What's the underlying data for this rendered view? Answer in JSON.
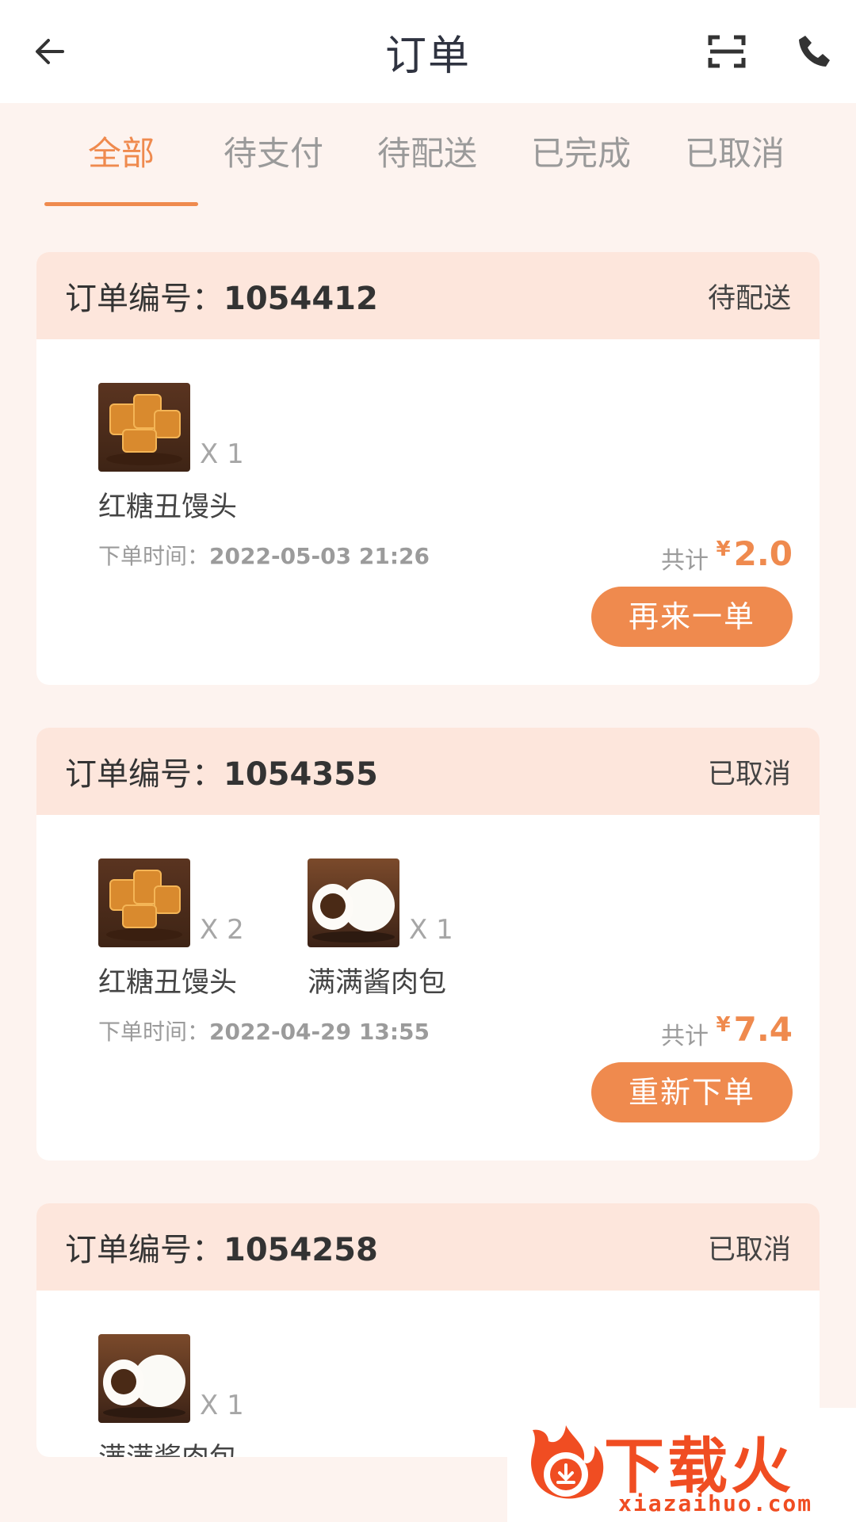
{
  "header": {
    "title": "订单",
    "icons": [
      "back-arrow-icon",
      "scan-icon",
      "phone-icon"
    ]
  },
  "tabs": [
    {
      "label": "全部",
      "active": true
    },
    {
      "label": "待支付",
      "active": false
    },
    {
      "label": "待配送",
      "active": false
    },
    {
      "label": "已完成",
      "active": false
    },
    {
      "label": "已取消",
      "active": false
    }
  ],
  "orders": [
    {
      "number_label": "订单编号：",
      "number": "1054412",
      "status": "待配送",
      "items": [
        {
          "name": "红糖丑馒头",
          "qty": "X 1",
          "thumb": "brown-sugar-bread"
        }
      ],
      "time_label": "下单时间：",
      "time": "2022-05-03 21:26",
      "total_label": "共计",
      "currency": "¥",
      "total": "2.0",
      "action": "再来一单"
    },
    {
      "number_label": "订单编号：",
      "number": "1054355",
      "status": "已取消",
      "items": [
        {
          "name": "红糖丑馒头",
          "qty": "X 2",
          "thumb": "brown-sugar-bread"
        },
        {
          "name": "满满酱肉包",
          "qty": "X 1",
          "thumb": "meat-bun"
        }
      ],
      "time_label": "下单时间：",
      "time": "2022-04-29 13:55",
      "total_label": "共计",
      "currency": "¥",
      "total": "7.4",
      "action": "重新下单"
    },
    {
      "number_label": "订单编号：",
      "number": "1054258",
      "status": "已取消",
      "items": [
        {
          "name": "满满酱肉包",
          "qty": "X 1",
          "thumb": "meat-bun"
        }
      ]
    }
  ],
  "watermark": {
    "brand": "下载火",
    "url": "xiazaihuo.com"
  },
  "colors": {
    "accent": "#ef8a4e",
    "header_band": "#fde6dc",
    "page_bg": "#fdf3ef"
  }
}
